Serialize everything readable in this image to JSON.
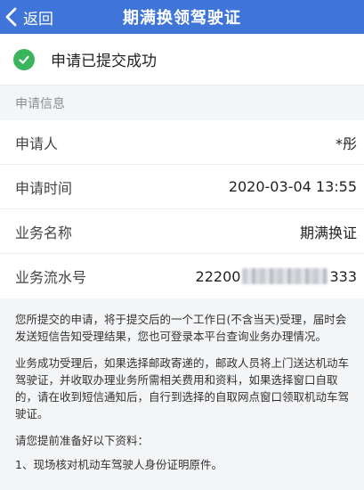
{
  "navbar": {
    "back_label": "返回",
    "title": "期满换领驾驶证"
  },
  "status": {
    "message": "申请已提交成功",
    "color": "#3bb55c"
  },
  "section": {
    "title": "申请信息"
  },
  "info": {
    "applicant_label": "申请人",
    "applicant_value": "*彤",
    "time_label": "申请时间",
    "time_value": "2020-03-04 13:55",
    "business_label": "业务名称",
    "business_value": "期满换证",
    "serial_label": "业务流水号",
    "serial_prefix": "22200",
    "serial_suffix": "333"
  },
  "notice": {
    "p1": "您所提交的申请，将于提交后的一个工作日(不含当天)受理，届时会发送短信告知受理结果，您也可登录本平台查询业务办理情况。",
    "p2": "业务成功受理后，如果选择邮政寄递的，邮政人员将上门送达机动车驾驶证，并收取办理业务所需相关费用和资料，如果选择窗口自取的，请在收到短信通知后，自行到选择的自取网点窗口领取机动车驾驶证。",
    "p3": "请您提前准备好以下资料：",
    "p4": "1、现场核对机动车驾驶人身份证明原件。"
  },
  "colors": {
    "navbar": "#3f74d8",
    "background": "#f4f5f7"
  }
}
